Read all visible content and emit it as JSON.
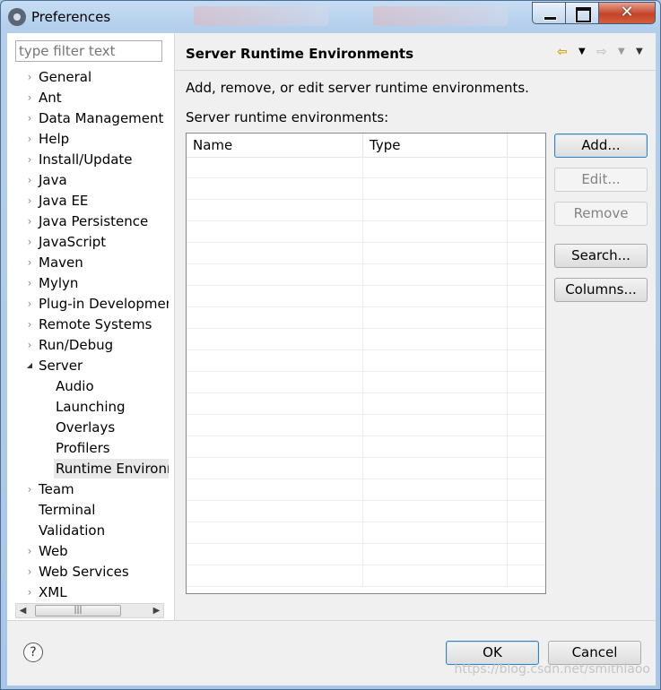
{
  "window": {
    "title": "Preferences"
  },
  "filter": {
    "placeholder": "type filter text"
  },
  "tree": [
    {
      "label": "General",
      "arrow": "›",
      "level": 0
    },
    {
      "label": "Ant",
      "arrow": "›",
      "level": 0
    },
    {
      "label": "Data Management",
      "arrow": "›",
      "level": 0
    },
    {
      "label": "Help",
      "arrow": "›",
      "level": 0
    },
    {
      "label": "Install/Update",
      "arrow": "›",
      "level": 0
    },
    {
      "label": "Java",
      "arrow": "›",
      "level": 0
    },
    {
      "label": "Java EE",
      "arrow": "›",
      "level": 0
    },
    {
      "label": "Java Persistence",
      "arrow": "›",
      "level": 0
    },
    {
      "label": "JavaScript",
      "arrow": "›",
      "level": 0
    },
    {
      "label": "Maven",
      "arrow": "›",
      "level": 0
    },
    {
      "label": "Mylyn",
      "arrow": "›",
      "level": 0
    },
    {
      "label": "Plug-in Development",
      "arrow": "›",
      "level": 0
    },
    {
      "label": "Remote Systems",
      "arrow": "›",
      "level": 0
    },
    {
      "label": "Run/Debug",
      "arrow": "›",
      "level": 0
    },
    {
      "label": "Server",
      "arrow": "◢",
      "level": 0
    },
    {
      "label": "Audio",
      "arrow": "",
      "level": 1
    },
    {
      "label": "Launching",
      "arrow": "",
      "level": 1
    },
    {
      "label": "Overlays",
      "arrow": "",
      "level": 1
    },
    {
      "label": "Profilers",
      "arrow": "",
      "level": 1
    },
    {
      "label": "Runtime Environments",
      "arrow": "",
      "level": 1,
      "selected": true
    },
    {
      "label": "Team",
      "arrow": "›",
      "level": 0
    },
    {
      "label": "Terminal",
      "arrow": "",
      "level": 0
    },
    {
      "label": "Validation",
      "arrow": "",
      "level": 0
    },
    {
      "label": "Web",
      "arrow": "›",
      "level": 0
    },
    {
      "label": "Web Services",
      "arrow": "›",
      "level": 0
    },
    {
      "label": "XML",
      "arrow": "›",
      "level": 0
    }
  ],
  "page": {
    "title": "Server Runtime Environments",
    "description": "Add, remove, or edit server runtime environments.",
    "list_label": "Server runtime environments:",
    "columns": [
      "Name",
      "Type"
    ],
    "rows": []
  },
  "buttons": {
    "add": "Add...",
    "edit": "Edit...",
    "remove": "Remove",
    "search": "Search...",
    "columns": "Columns...",
    "ok": "OK",
    "cancel": "Cancel"
  },
  "nav": {
    "back": "⇦",
    "forward": "⇨",
    "dropdown": "▼"
  },
  "watermark": "https://blog.csdn.net/smithlaoo",
  "colors": {
    "accent": "#3c7fb1",
    "back_arrow": "#d9a400"
  }
}
